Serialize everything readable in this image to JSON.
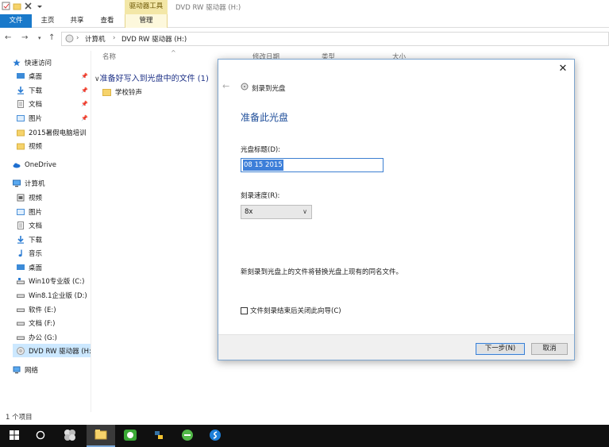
{
  "window": {
    "title": "DVD RW 驱动器 (H:)",
    "context_tab_group": "驱动器工具"
  },
  "ribbon": {
    "tabs": [
      "文件",
      "主页",
      "共享",
      "查看",
      "管理"
    ]
  },
  "address": {
    "crumbs": [
      "计算机",
      "DVD RW 驱动器 (H:)"
    ]
  },
  "sidebar": {
    "quick_access": "快速访问",
    "quick_items": [
      "桌面",
      "下载",
      "文档",
      "图片",
      "2015暑假电脑培训",
      "视频"
    ],
    "onedrive": "OneDrive",
    "computer": "计算机",
    "computer_items": [
      "视频",
      "图片",
      "文档",
      "下载",
      "音乐",
      "桌面",
      "Win10专业版 (C:)",
      "Win8.1企业版 (D:)",
      "软件 (E:)",
      "文档 (F:)",
      "办公 (G:)",
      "DVD RW 驱动器 (H:)"
    ],
    "network": "网络"
  },
  "content": {
    "columns": [
      "名称",
      "修改日期",
      "类型",
      "大小"
    ],
    "group_header": "准备好写入到光盘中的文件 (1)",
    "files": [
      "学校铃声"
    ]
  },
  "status_bar": {
    "item_count": "1 个项目"
  },
  "dialog": {
    "caption": "刻录到光盘",
    "heading": "准备此光盘",
    "title_label": "光盘标题(D):",
    "title_value": "08 15 2015",
    "speed_label": "刻录速度(R):",
    "speed_value": "8x",
    "note": "新刻录到光盘上的文件将替换光盘上现有的同名文件。",
    "checkbox_label": "文件刻录结束后关闭此向导(C)",
    "next_label": "下一步(N)",
    "cancel_label": "取消"
  },
  "colors": {
    "accent": "#1979ca",
    "heading_blue": "#1f4e9a",
    "context_tab": "#f3e7a7",
    "selection": "#cce8ff"
  }
}
